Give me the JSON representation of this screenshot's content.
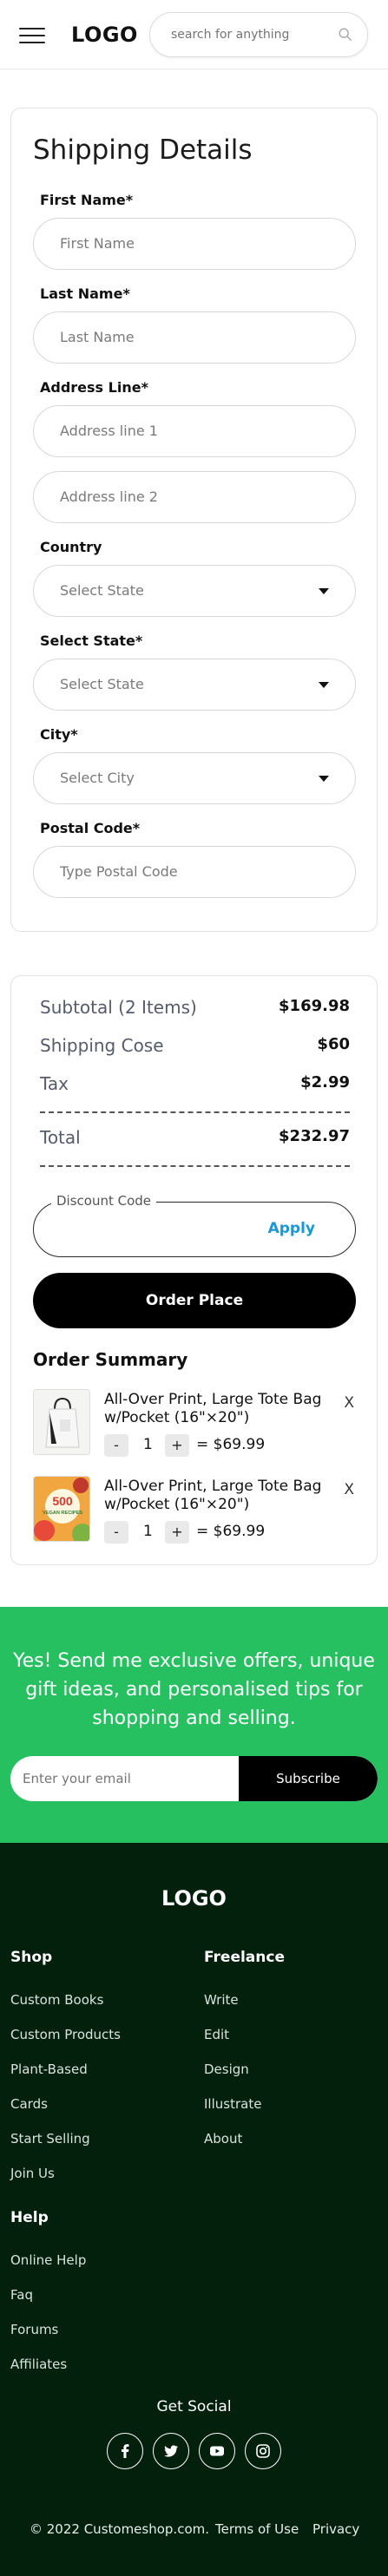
{
  "header": {
    "logo": "LOGO",
    "search_placeholder": "search for anything",
    "menu_icon": "hamburger-menu-icon",
    "search_icon": "search-icon"
  },
  "shipping": {
    "title": "Shipping Details",
    "first_name_label": "First Name*",
    "first_name_placeholder": "First Name",
    "last_name_label": "Last Name*",
    "last_name_placeholder": "Last Name",
    "address_label": "Address Line*",
    "address1_placeholder": "Address line 1",
    "address2_placeholder": "Address line 2",
    "country_label": "Country",
    "country_value": "Select State",
    "state_label": "Select State*",
    "state_value": "Select State",
    "city_label": "City*",
    "city_value": "Select City",
    "postal_label": "Postal Code*",
    "postal_placeholder": "Type Postal Code"
  },
  "totals": {
    "subtotal_label": "Subtotal (2 Items)",
    "subtotal_value": "$169.98",
    "shipping_label": "Shipping Cose",
    "shipping_value": "$60",
    "tax_label": "Tax",
    "tax_value": "$2.99",
    "total_label": "Total",
    "total_value": "$232.97",
    "discount_label": "Discount Code",
    "apply_label": "Apply",
    "order_button": "Order Place"
  },
  "order_summary": {
    "title": "Order Summary",
    "items": [
      {
        "name": "All-Over Print, Large Tote Bag w/Pocket (16\"×20\")",
        "minus": "-",
        "quantity": "1",
        "plus": "+",
        "price": "= $69.99",
        "remove": "X",
        "thumb_line1": "",
        "thumb_line2": ""
      },
      {
        "name": "All-Over Print, Large Tote Bag w/Pocket (16\"×20\")",
        "minus": "-",
        "quantity": "1",
        "plus": "+",
        "price": "= $69.99",
        "remove": "X",
        "thumb_line1": "500",
        "thumb_line2": "VEGAN RECIPES"
      }
    ]
  },
  "newsletter": {
    "text": "Yes! Send me exclusive offers, unique gift ideas, and personalised tips for shopping and selling.",
    "email_placeholder": "Enter your email",
    "subscribe": "Subscribe",
    "accent_color": "#27c061"
  },
  "footer": {
    "logo": "LOGO",
    "shop_heading": "Shop",
    "shop_links": [
      "Custom Books",
      "Custom Products",
      "Plant-Based",
      "Cards",
      "Start Selling",
      "Join Us"
    ],
    "freelance_heading": "Freelance",
    "freelance_links": [
      "Write",
      "Edit",
      "Design",
      "Illustrate",
      "About"
    ],
    "help_heading": "Help",
    "help_links": [
      "Online Help",
      "Faq",
      "Forums",
      "Affiliates"
    ],
    "get_social": "Get Social",
    "social_icons": [
      "facebook-icon",
      "twitter-icon",
      "youtube-icon",
      "instagram-icon"
    ],
    "copyright": "© 2022 Customeshop.com.",
    "terms": "Terms of Use",
    "privacy": "Privacy",
    "background_color": "#03200d"
  }
}
